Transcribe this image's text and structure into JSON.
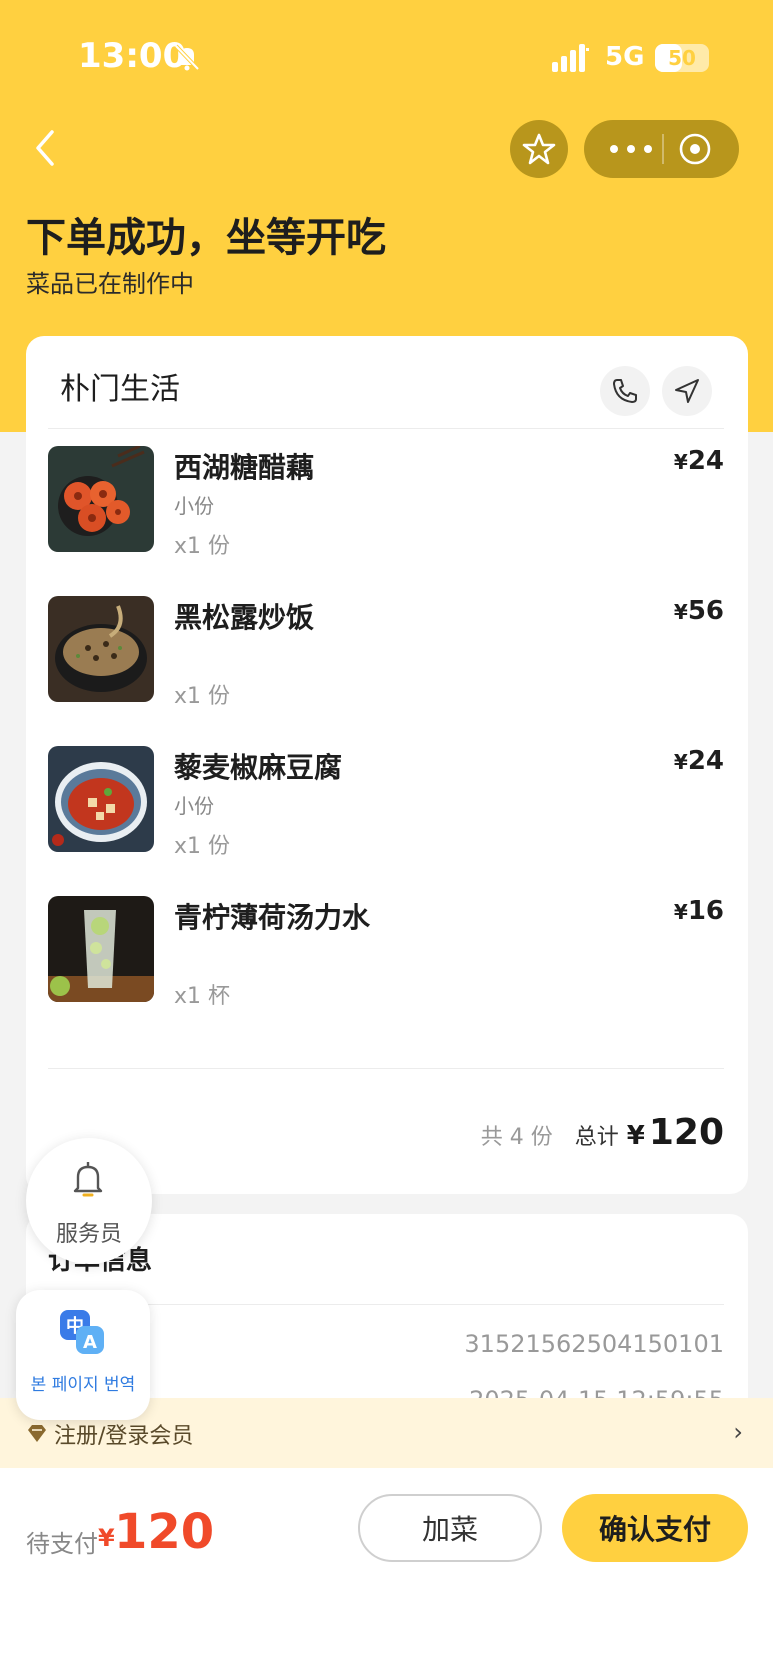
{
  "status_bar": {
    "time": "13:00",
    "network": "5G",
    "battery": "50",
    "battery_level": 0.5
  },
  "header": {
    "title": "下单成功，坐等开吃",
    "subtitle": "菜品已在制作中"
  },
  "restaurant": {
    "name": "朴门生活"
  },
  "order_items": [
    {
      "name": "西湖糖醋藕",
      "spec": "小份",
      "quantity": "x1 份",
      "price_symbol": "¥",
      "price": "24"
    },
    {
      "name": "黑松露炒饭",
      "spec": "",
      "quantity": "x1 份",
      "price_symbol": "¥",
      "price": "56"
    },
    {
      "name": "藜麦椒麻豆腐",
      "spec": "小份",
      "quantity": "x1 份",
      "price_symbol": "¥",
      "price": "24"
    },
    {
      "name": "青柠薄荷汤力水",
      "spec": "",
      "quantity": "x1 杯",
      "price_symbol": "¥",
      "price": "16"
    }
  ],
  "summary": {
    "count_text": "共 4 份",
    "total_label": "总计",
    "currency": "¥",
    "total": "120"
  },
  "order_info": {
    "title": "订单信息",
    "order_number": "31521562504150101",
    "order_time": "2025-04-15 12:59:55"
  },
  "member_bar": {
    "text": "注册/登录会员",
    "arrow": "›"
  },
  "floating": {
    "waiter_label": "服务员",
    "translate_label": "본 페이지 번역"
  },
  "bottom_bar": {
    "pending_label": "待支付",
    "currency": "¥",
    "amount": "120",
    "add_label": "加菜",
    "confirm_label": "确认支付"
  },
  "colors": {
    "brand_yellow": "#ffd040",
    "price_red": "#f04a2a",
    "capsule_gold": "#b8961c"
  }
}
